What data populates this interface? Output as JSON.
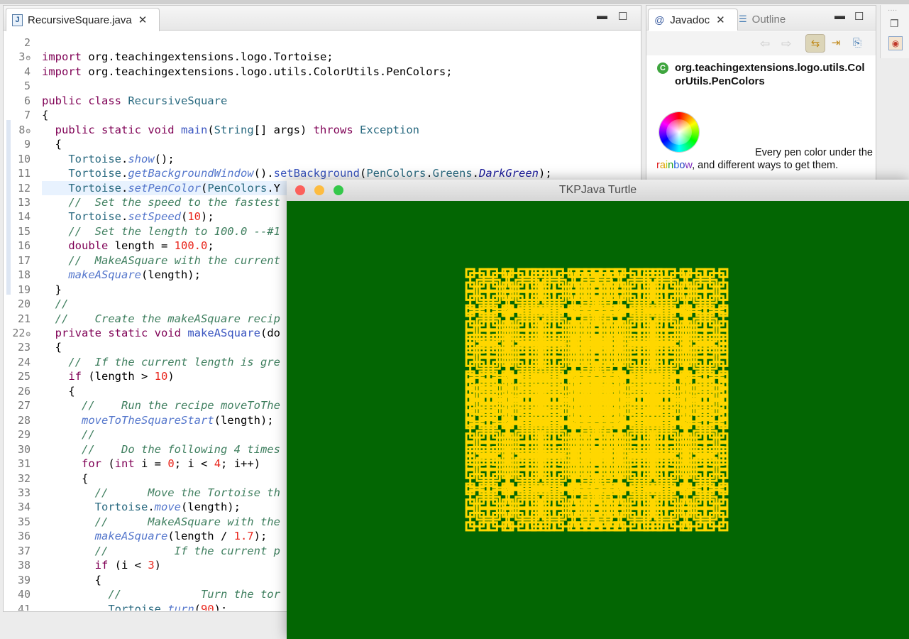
{
  "editor": {
    "tab_label": "RecursiveSquare.java",
    "lines": [
      {
        "n": "2",
        "fold": false,
        "html": ""
      },
      {
        "n": "3",
        "fold": true,
        "html": "<span class=\"kw\">import</span> org.teachingextensions.logo.Tortoise;"
      },
      {
        "n": "4",
        "fold": false,
        "html": "<span class=\"kw\">import</span> org.teachingextensions.logo.utils.ColorUtils.PenColors;"
      },
      {
        "n": "5",
        "fold": false,
        "html": ""
      },
      {
        "n": "6",
        "fold": false,
        "html": "<span class=\"kw\">public class</span> <span class=\"ty\">RecursiveSquare</span>"
      },
      {
        "n": "7",
        "fold": false,
        "html": "{"
      },
      {
        "n": "8",
        "fold": true,
        "html": "  <span class=\"kw\">public static void</span> <span class=\"md\">main</span>(<span class=\"ty\">String</span>[] args) <span class=\"kw\">throws</span> <span class=\"ty\">Exception</span>"
      },
      {
        "n": "9",
        "fold": false,
        "html": "  {"
      },
      {
        "n": "10",
        "fold": false,
        "html": "    <span class=\"ty\">Tortoise</span>.<span class=\"mt\">show</span>();"
      },
      {
        "n": "11",
        "fold": false,
        "html": "    <span class=\"ty\">Tortoise</span>.<span class=\"mt\">getBackgroundWindow</span>().<span class=\"md\">setBackground</span>(<span class=\"ty\">PenColors</span>.<span class=\"ty\">Greens</span>.<span class=\"it\">DarkGreen</span>);"
      },
      {
        "n": "12",
        "fold": false,
        "html": "    <span class=\"ty\">Tortoise</span>.<span class=\"mt\">setPenColor</span>(<span class=\"ty\">PenColors</span>.Y"
      },
      {
        "n": "13",
        "fold": false,
        "html": "    <span class=\"cm\">//  Set the speed to the fastest</span>"
      },
      {
        "n": "14",
        "fold": false,
        "html": "    <span class=\"ty\">Tortoise</span>.<span class=\"mt\">setSpeed</span>(<span class=\"num\">10</span>);"
      },
      {
        "n": "15",
        "fold": false,
        "html": "    <span class=\"cm\">//  Set the length to 100.0 --#1</span>"
      },
      {
        "n": "16",
        "fold": false,
        "html": "    <span class=\"kw\">double</span> length = <span class=\"num\">100.0</span>;"
      },
      {
        "n": "17",
        "fold": false,
        "html": "    <span class=\"cm\">//  MakeASquare with the current</span>"
      },
      {
        "n": "18",
        "fold": false,
        "html": "    <span class=\"mt\">makeASquare</span>(length);"
      },
      {
        "n": "19",
        "fold": false,
        "html": "  }"
      },
      {
        "n": "20",
        "fold": false,
        "html": "  <span class=\"cm\">//</span>"
      },
      {
        "n": "21",
        "fold": false,
        "html": "  <span class=\"cm\">//    Create the makeASquare recip</span>"
      },
      {
        "n": "22",
        "fold": true,
        "html": "  <span class=\"kw\">private static void</span> <span class=\"md\">makeASquare</span>(do"
      },
      {
        "n": "23",
        "fold": false,
        "html": "  {"
      },
      {
        "n": "24",
        "fold": false,
        "html": "    <span class=\"cm\">//  If the current length is gre</span>"
      },
      {
        "n": "25",
        "fold": false,
        "html": "    <span class=\"kw\">if</span> (length &gt; <span class=\"num\">10</span>)"
      },
      {
        "n": "26",
        "fold": false,
        "html": "    {"
      },
      {
        "n": "27",
        "fold": false,
        "html": "      <span class=\"cm\">//    Run the recipe moveToThe</span>"
      },
      {
        "n": "28",
        "fold": false,
        "html": "      <span class=\"mt\">moveToTheSquareStart</span>(length);"
      },
      {
        "n": "29",
        "fold": false,
        "html": "      <span class=\"cm\">//</span>"
      },
      {
        "n": "30",
        "fold": false,
        "html": "      <span class=\"cm\">//    Do the following 4 times</span>"
      },
      {
        "n": "31",
        "fold": false,
        "html": "      <span class=\"kw\">for</span> (<span class=\"kw\">int</span> i = <span class=\"num\">0</span>; i &lt; <span class=\"num\">4</span>; i++)"
      },
      {
        "n": "32",
        "fold": false,
        "html": "      {"
      },
      {
        "n": "33",
        "fold": false,
        "html": "        <span class=\"cm\">//      Move the Tortoise th</span>"
      },
      {
        "n": "34",
        "fold": false,
        "html": "        <span class=\"ty\">Tortoise</span>.<span class=\"mt\">move</span>(length);"
      },
      {
        "n": "35",
        "fold": false,
        "html": "        <span class=\"cm\">//      MakeASquare with the</span>"
      },
      {
        "n": "36",
        "fold": false,
        "html": "        <span class=\"mt\">makeASquare</span>(length / <span class=\"num\">1.7</span>);"
      },
      {
        "n": "37",
        "fold": false,
        "html": "        <span class=\"cm\">//          If the current p</span>"
      },
      {
        "n": "38",
        "fold": false,
        "html": "        <span class=\"kw\">if</span> (i &lt; <span class=\"num\">3</span>)"
      },
      {
        "n": "39",
        "fold": false,
        "html": "        {"
      },
      {
        "n": "40",
        "fold": false,
        "html": "          <span class=\"cm\">//            Turn the tor</span>"
      },
      {
        "n": "41",
        "fold": false,
        "html": "          <span class=\"ty\">Tortoise</span>.<span class=\"mt\">turn</span>(<span class=\"num\">90</span>);"
      }
    ]
  },
  "javadoc": {
    "tab_javadoc": "Javadoc",
    "tab_outline": "Outline",
    "class_name": "org.teachingextensions.logo.utils.ColorUtils.PenColors",
    "desc_prefix": "Every pen color under the",
    "desc_rainbow": "rainbow",
    "desc_suffix": ", and different ways to get them."
  },
  "turtle_window": {
    "title": "TKPJava Turtle",
    "background": "#036603",
    "pen_color": "#ffd700"
  },
  "colors": {
    "close": "#fc605b",
    "minimize": "#fdbc40",
    "zoom": "#34c84a"
  }
}
